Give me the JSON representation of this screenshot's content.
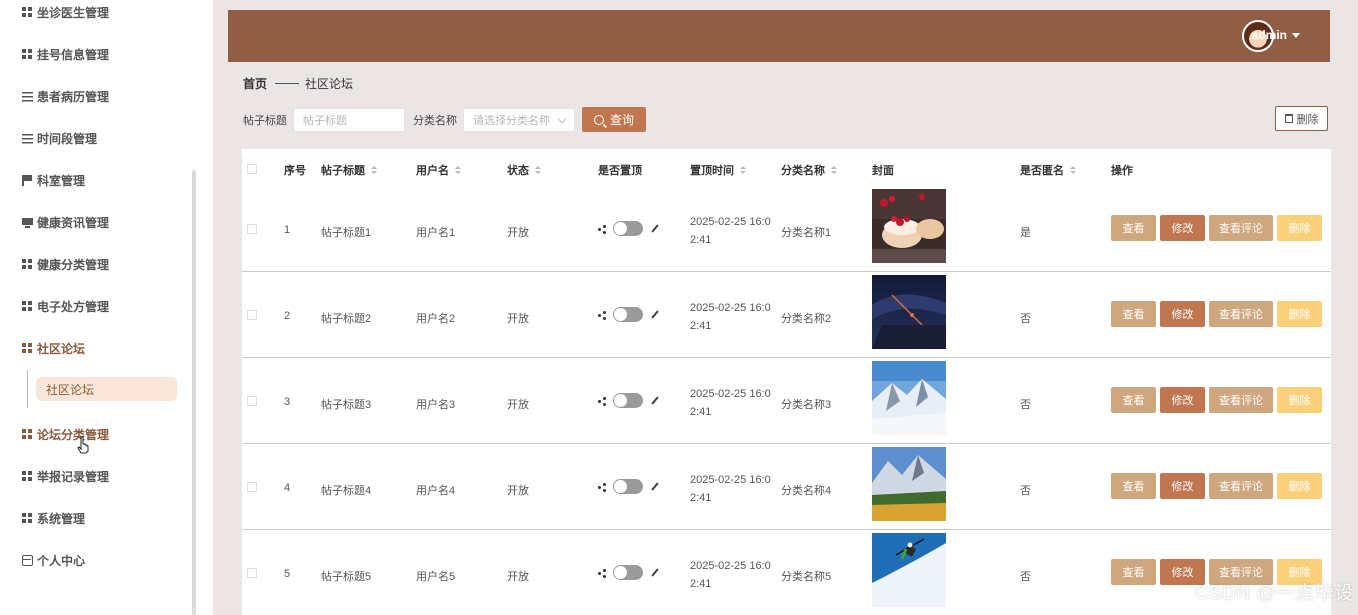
{
  "sidebar": {
    "items": [
      {
        "label": "坐诊医生管理",
        "icon": "grid-icon"
      },
      {
        "label": "挂号信息管理",
        "icon": "grid-icon"
      },
      {
        "label": "患者病历管理",
        "icon": "sliders-icon"
      },
      {
        "label": "时间段管理",
        "icon": "list-icon"
      },
      {
        "label": "科室管理",
        "icon": "flag-icon"
      },
      {
        "label": "健康资讯管理",
        "icon": "monitor-icon"
      },
      {
        "label": "健康分类管理",
        "icon": "grid-icon"
      },
      {
        "label": "电子处方管理",
        "icon": "grid-icon"
      },
      {
        "label": "社区论坛",
        "icon": "grid-icon"
      },
      {
        "label": "论坛分类管理",
        "icon": "grid-icon"
      },
      {
        "label": "举报记录管理",
        "icon": "grid-icon"
      },
      {
        "label": "系统管理",
        "icon": "grid-icon"
      },
      {
        "label": "个人中心",
        "icon": "card-icon"
      }
    ],
    "active_sub": "社区论坛"
  },
  "header": {
    "user": "admin"
  },
  "breadcrumb": {
    "home": "首页",
    "current": "社区论坛"
  },
  "search": {
    "title_label": "帖子标题",
    "title_placeholder": "帖子标题",
    "category_label": "分类名称",
    "category_placeholder": "请选择分类名称",
    "query_button": "查询",
    "delete_button": "删除"
  },
  "table": {
    "headers": [
      "序号",
      "帖子标题",
      "用户名",
      "状态",
      "是否置顶",
      "置顶时间",
      "分类名称",
      "封面",
      "是否匿名",
      "操作"
    ],
    "rows": [
      {
        "no": "1",
        "title": "帖子标题1",
        "user": "用户名1",
        "status": "开放",
        "time1": "2025-02-25 16:0",
        "time2": "2:41",
        "category": "分类名称1",
        "anon": "是"
      },
      {
        "no": "2",
        "title": "帖子标题2",
        "user": "用户名2",
        "status": "开放",
        "time1": "2025-02-25 16:0",
        "time2": "2:41",
        "category": "分类名称2",
        "anon": "否"
      },
      {
        "no": "3",
        "title": "帖子标题3",
        "user": "用户名3",
        "status": "开放",
        "time1": "2025-02-25 16:0",
        "time2": "2:41",
        "category": "分类名称3",
        "anon": "否"
      },
      {
        "no": "4",
        "title": "帖子标题4",
        "user": "用户名4",
        "status": "开放",
        "time1": "2025-02-25 16:0",
        "time2": "2:41",
        "category": "分类名称4",
        "anon": "否"
      },
      {
        "no": "5",
        "title": "帖子标题5",
        "user": "用户名5",
        "status": "开放",
        "time1": "2025-02-25 16:0",
        "time2": "2:41",
        "category": "分类名称5",
        "anon": "否"
      }
    ],
    "actions": {
      "view": "查看",
      "edit": "修改",
      "comments": "查看评论",
      "delete": "删除"
    }
  },
  "watermark": "CSDN @一点毕设",
  "colors": {
    "brand": "#8f5e43",
    "query": "#c0764f",
    "view": "#cfa77f",
    "delete": "#fbd07a"
  }
}
